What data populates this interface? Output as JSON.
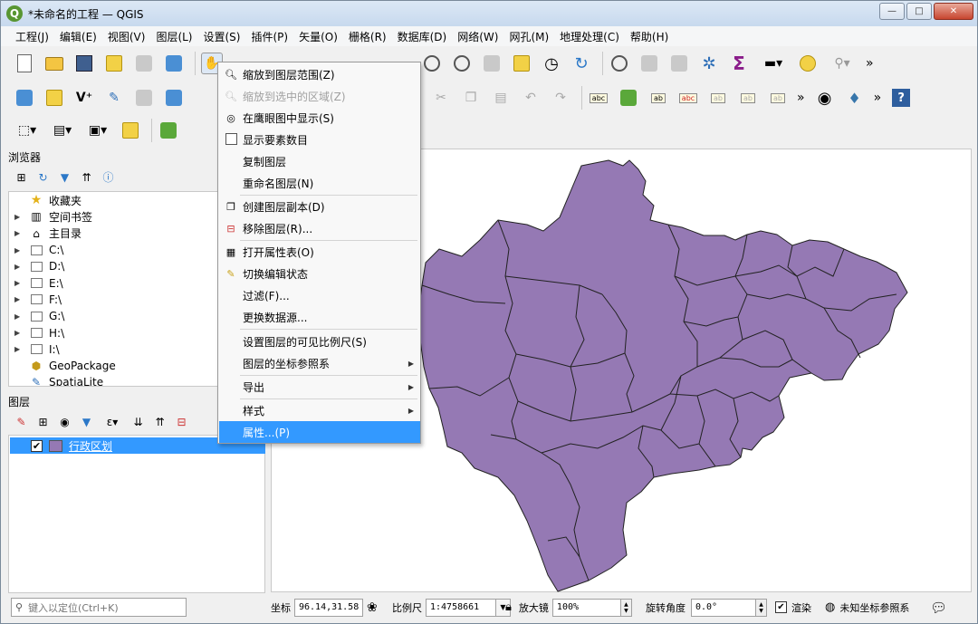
{
  "window": {
    "title": "*未命名的工程 — QGIS",
    "logo_letter": "Q",
    "controls": {
      "minimize": "—",
      "maximize": "□",
      "close": "✕"
    }
  },
  "menubar": [
    "工程(J)",
    "编辑(E)",
    "视图(V)",
    "图层(L)",
    "设置(S)",
    "插件(P)",
    "矢量(O)",
    "栅格(R)",
    "数据库(D)",
    "网络(W)",
    "网孔(M)",
    "地理处理(C)",
    "帮助(H)"
  ],
  "toolbar_overflow": "»",
  "browser_panel": {
    "title": "浏览器",
    "items": [
      {
        "label": "收藏夹",
        "icon": "star-icon",
        "expandable": false
      },
      {
        "label": "空间书签",
        "icon": "bookmark-icon",
        "expandable": true
      },
      {
        "label": "主目录",
        "icon": "home-icon",
        "expandable": true
      },
      {
        "label": "C:\\",
        "icon": "drive-icon",
        "expandable": true
      },
      {
        "label": "D:\\",
        "icon": "drive-icon",
        "expandable": true
      },
      {
        "label": "E:\\",
        "icon": "drive-icon",
        "expandable": true
      },
      {
        "label": "F:\\",
        "icon": "drive-icon",
        "expandable": true
      },
      {
        "label": "G:\\",
        "icon": "drive-icon",
        "expandable": true
      },
      {
        "label": "H:\\",
        "icon": "drive-icon",
        "expandable": true
      },
      {
        "label": "I:\\",
        "icon": "drive-icon",
        "expandable": true
      },
      {
        "label": "GeoPackage",
        "icon": "geopackage-icon",
        "expandable": false
      },
      {
        "label": "SpatiaLite",
        "icon": "spatialite-icon",
        "expandable": false
      }
    ]
  },
  "layers_panel": {
    "title": "图层",
    "layers": [
      {
        "name": "行政区划",
        "checked": true,
        "color": "#9579b4"
      }
    ]
  },
  "context_menu": {
    "items": [
      {
        "label": "缩放到图层范围(Z)",
        "icon": "zoom-layer-icon"
      },
      {
        "label": "缩放到选中的区域(Z)",
        "icon": "zoom-selection-icon",
        "disabled": true
      },
      {
        "label": "在鹰眼图中显示(S)",
        "icon": "overview-icon"
      },
      {
        "label": "显示要素数目",
        "checkbox": true
      },
      {
        "label": "复制图层"
      },
      {
        "label": "重命名图层(N)"
      },
      {
        "label": "创建图层副本(D)",
        "icon": "duplicate-icon"
      },
      {
        "label": "移除图层(R)...",
        "icon": "remove-layer-icon"
      },
      {
        "label": "打开属性表(O)",
        "icon": "attribute-table-icon"
      },
      {
        "label": "切换编辑状态",
        "icon": "pencil-icon"
      },
      {
        "label": "过滤(F)..."
      },
      {
        "label": "更换数据源..."
      },
      {
        "label": "设置图层的可见比例尺(S)"
      },
      {
        "label": "图层的坐标参照系",
        "submenu": true
      },
      {
        "label": "导出",
        "submenu": true
      },
      {
        "label": "样式",
        "submenu": true
      },
      {
        "label": "属性...(P)",
        "active": true
      }
    ]
  },
  "statusbar": {
    "locator_placeholder": "键入以定位(Ctrl+K)",
    "coordinate_label": "坐标",
    "coordinate_value": "96.14,31.58",
    "scale_label": "比例尺",
    "scale_value": "1:4758661",
    "magnifier_label": "放大镜",
    "magnifier_value": "100%",
    "rotation_label": "旋转角度",
    "rotation_value": "0.0°",
    "render_label": "渲染",
    "render_checked": true,
    "crs_label": "未知坐标参照系"
  },
  "colors": {
    "polygon_fill": "#9579b4",
    "polygon_stroke": "#222222",
    "selection": "#3399ff"
  }
}
